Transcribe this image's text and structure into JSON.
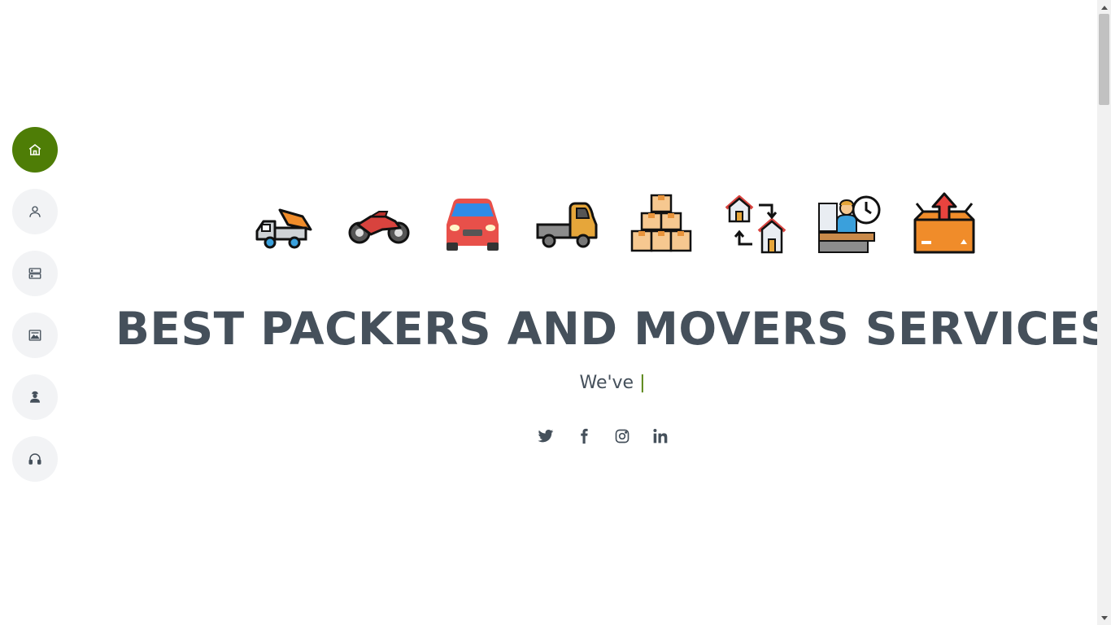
{
  "nav": {
    "items": [
      {
        "icon": "home-icon",
        "active": true
      },
      {
        "icon": "user-icon",
        "active": false
      },
      {
        "icon": "server-icon",
        "active": false
      },
      {
        "icon": "image-card-icon",
        "active": false
      },
      {
        "icon": "worker-icon",
        "active": false
      },
      {
        "icon": "headphones-icon",
        "active": false
      }
    ]
  },
  "hero": {
    "service_icons": [
      "tipper-truck-icon",
      "motorbike-icon",
      "car-icon",
      "pickup-truck-icon",
      "boxes-stack-icon",
      "house-relocation-icon",
      "cashier-clock-icon",
      "open-box-icon"
    ],
    "title": "BEST PACKERS AND MOVERS SERVICES",
    "typed_text": "We've ",
    "typed_cursor": "|"
  },
  "social": [
    "twitter-icon",
    "facebook-icon",
    "instagram-icon",
    "linkedin-icon"
  ],
  "colors": {
    "accent": "#4e7d06",
    "text": "#45505b",
    "nav_bg": "#f2f3f5"
  }
}
